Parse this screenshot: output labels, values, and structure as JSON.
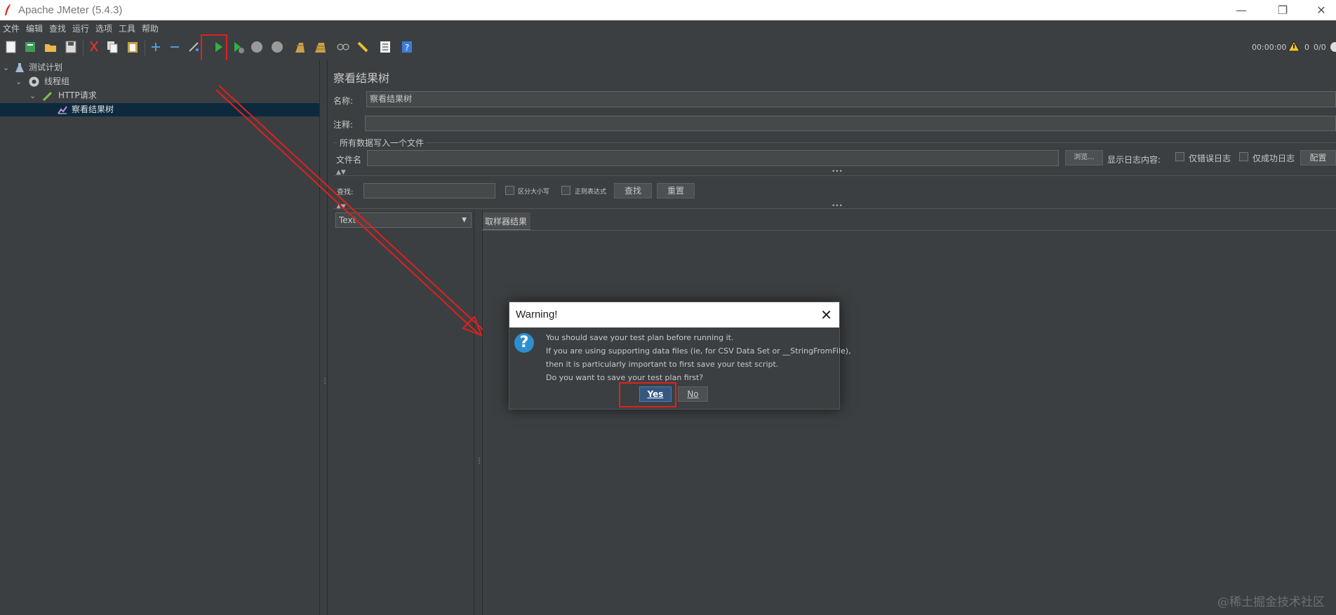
{
  "window": {
    "title": "Apache JMeter (5.4.3)"
  },
  "menu": [
    "文件",
    "编辑",
    "查找",
    "运行",
    "选项",
    "工具",
    "帮助"
  ],
  "toolbar": {
    "icons": [
      "new-icon",
      "templates-icon",
      "open-icon",
      "save-icon",
      "cut-icon",
      "copy-icon",
      "paste-icon",
      "expand-icon",
      "collapse-icon",
      "toggle-icon",
      "start-icon",
      "start-no-timers-icon",
      "stop-icon",
      "shutdown-icon",
      "clear-icon",
      "clear-all-icon",
      "search-icon",
      "reset-search-icon",
      "function-helper-icon",
      "help-icon"
    ],
    "timer": "00:00:00",
    "warnings": "0",
    "threads": "0/0"
  },
  "tree": [
    {
      "label": "测试计划",
      "icon": "flask-icon"
    },
    {
      "label": "线程组",
      "icon": "gear-icon"
    },
    {
      "label": "HTTP请求",
      "icon": "pipette-icon"
    },
    {
      "label": "察看结果树",
      "icon": "chart-icon",
      "selected": true
    }
  ],
  "panel": {
    "title": "察看结果树",
    "name_label": "名称:",
    "name_value": "察看结果树",
    "comment_label": "注释:",
    "comment_value": "",
    "file_section": "所有数据写入一个文件",
    "file_label": "文件名",
    "browse_label": "浏览...",
    "log_content_label": "显示日志内容:",
    "errors_only_label": "仅错误日志",
    "success_only_label": "仅成功日志",
    "config_label": "配置",
    "search_label": "查找:",
    "case_label": "区分大小写",
    "regex_label": "正则表达式",
    "find_button": "查找",
    "reset_button": "重置",
    "renderer_value": "Text",
    "tab_label": "取样器结果"
  },
  "dialog": {
    "title": "Warning!",
    "lines": [
      "You should save your test plan before running it.",
      "If you are using supporting data files (ie, for CSV Data Set or __StringFromFile),",
      "then it is particularly important to first save your test script.",
      "Do you want to save your test plan first?"
    ],
    "yes_label": "Yes",
    "no_label": "No"
  },
  "watermark": "@稀土掘金技术社区",
  "colors": {
    "background": "#3c3f41",
    "selection": "#0d293e",
    "highlight": "#e02020",
    "accent": "#2d8fcf"
  }
}
